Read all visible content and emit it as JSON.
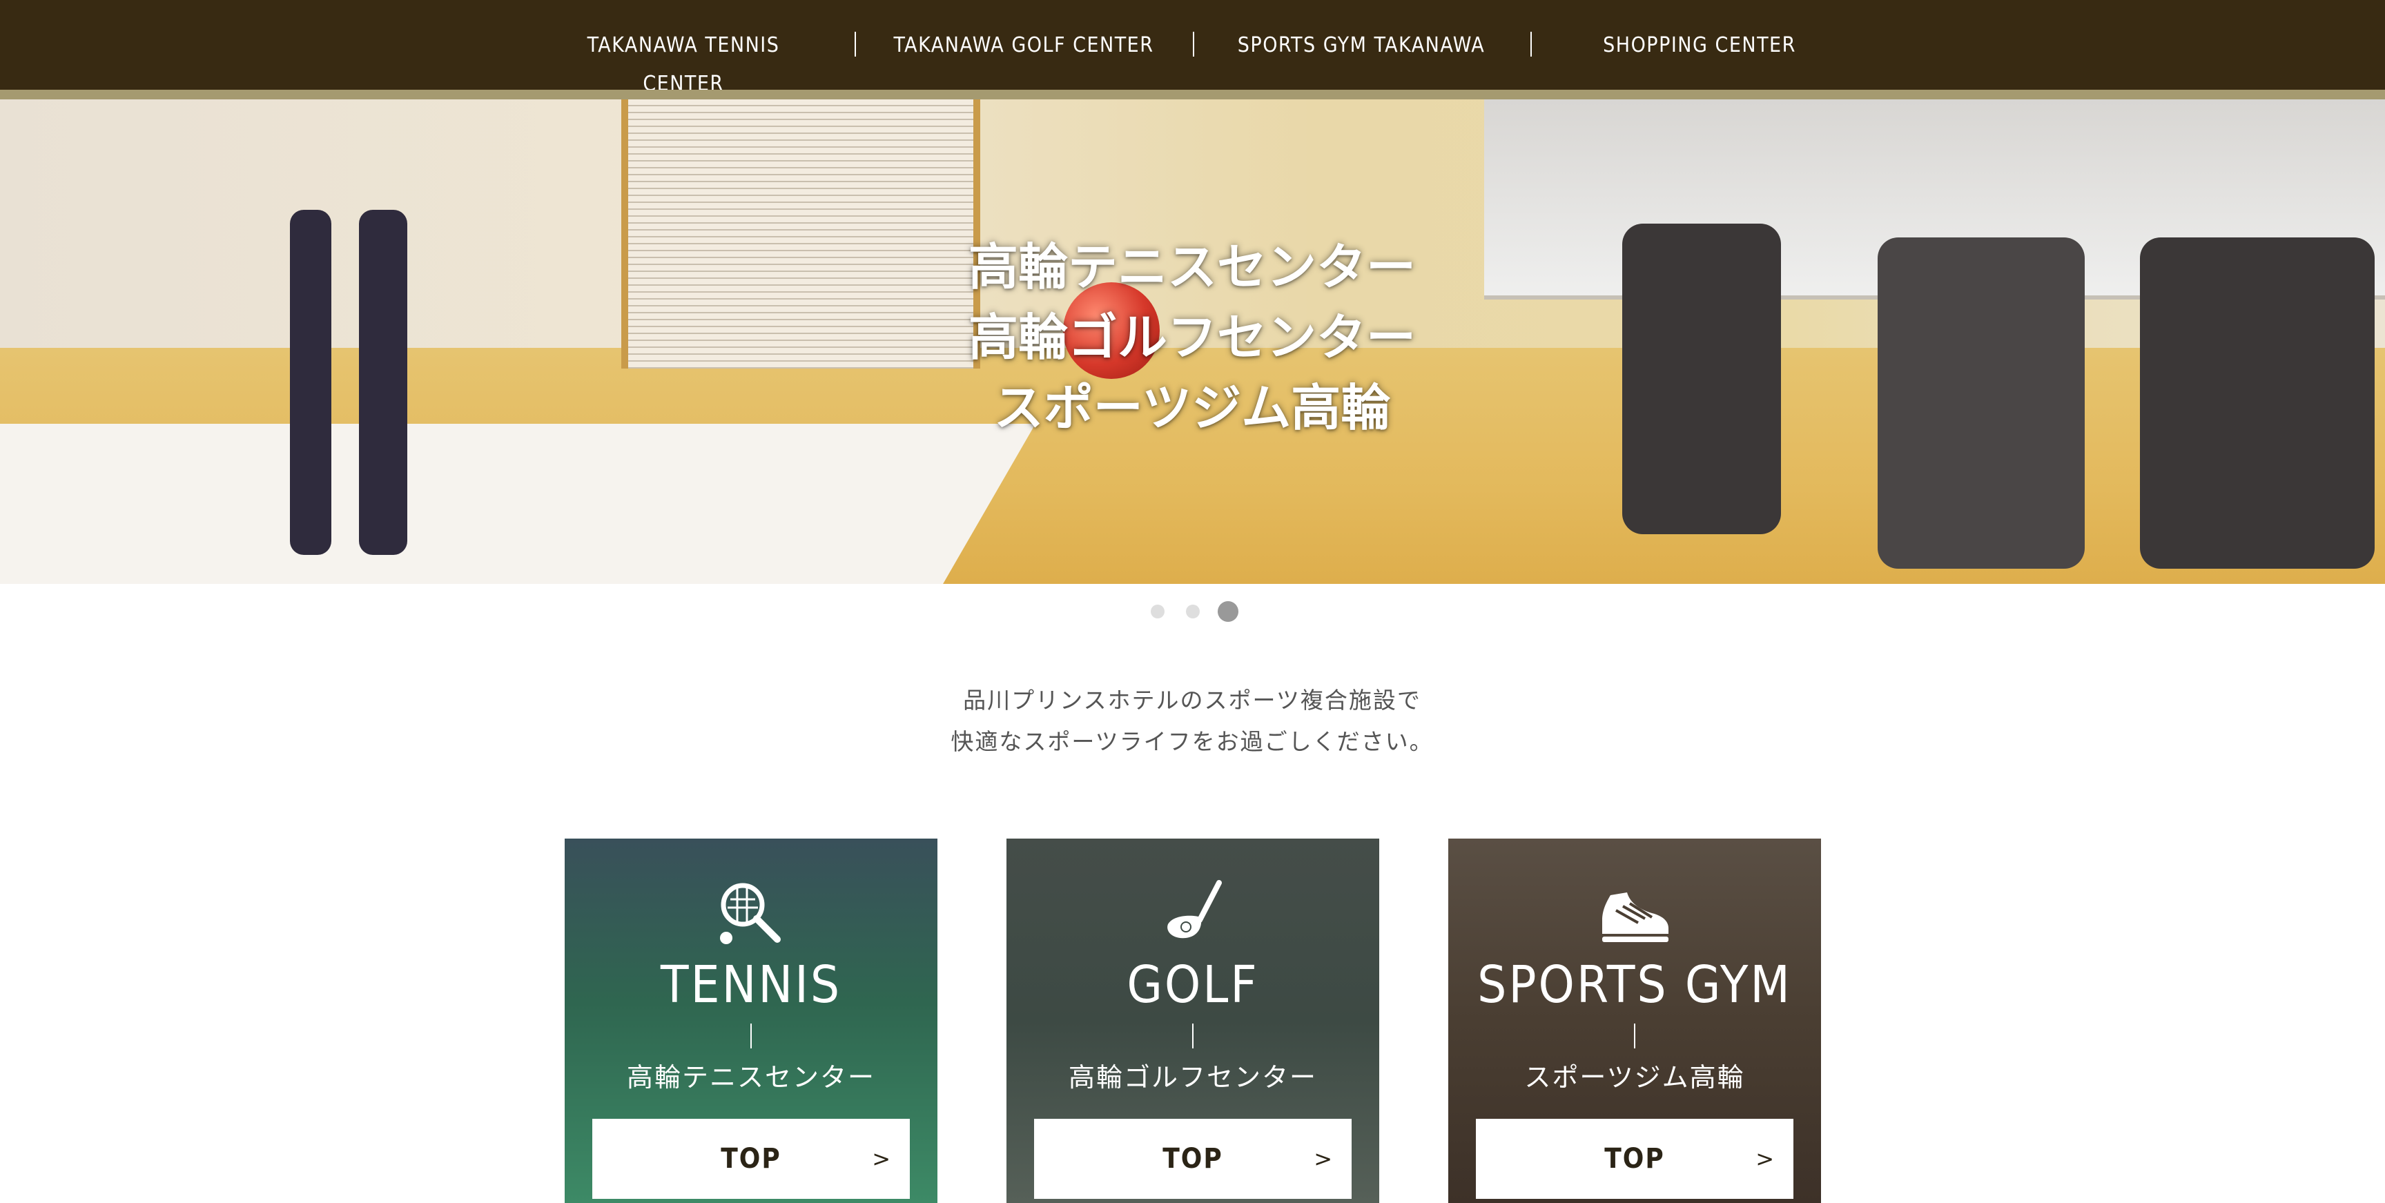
{
  "nav": {
    "items": [
      {
        "label": "TAKANAWA TENNIS CENTER"
      },
      {
        "label": "TAKANAWA GOLF CENTER"
      },
      {
        "label": "SPORTS GYM TAKANAWA"
      },
      {
        "label": "SHOPPING CENTER"
      }
    ]
  },
  "hero": {
    "lines": [
      "高輪テニスセンター",
      "高輪ゴルフセンター",
      "スポーツジム高輪"
    ]
  },
  "carousel": {
    "active_slide": 3,
    "slide_count": 3
  },
  "intro": {
    "lines": [
      "品川プリンスホテルのスポーツ複合施設で",
      "快適なスポーツライフをお過ごしください。"
    ]
  },
  "cards": [
    {
      "icon": "tennis-racket-icon",
      "title": "TENNIS",
      "subtitle": "高輪テニスセンター",
      "button": "TOP",
      "arrow": ">"
    },
    {
      "icon": "golf-club-icon",
      "title": "GOLF",
      "subtitle": "高輪ゴルフセンター",
      "button": "TOP",
      "arrow": ">"
    },
    {
      "icon": "sneaker-icon",
      "title": "SPORTS GYM",
      "subtitle": "スポーツジム高輪",
      "button": "TOP",
      "arrow": ">"
    }
  ],
  "colors": {
    "nav_bg": "#382a12",
    "nav_stripe": "#a59a70",
    "tennis_card": "#2f6b52",
    "golf_card": "#3d4a44",
    "gym_card": "#4a3e32",
    "dot_active": "#999999",
    "dot_inactive": "#dedede"
  }
}
